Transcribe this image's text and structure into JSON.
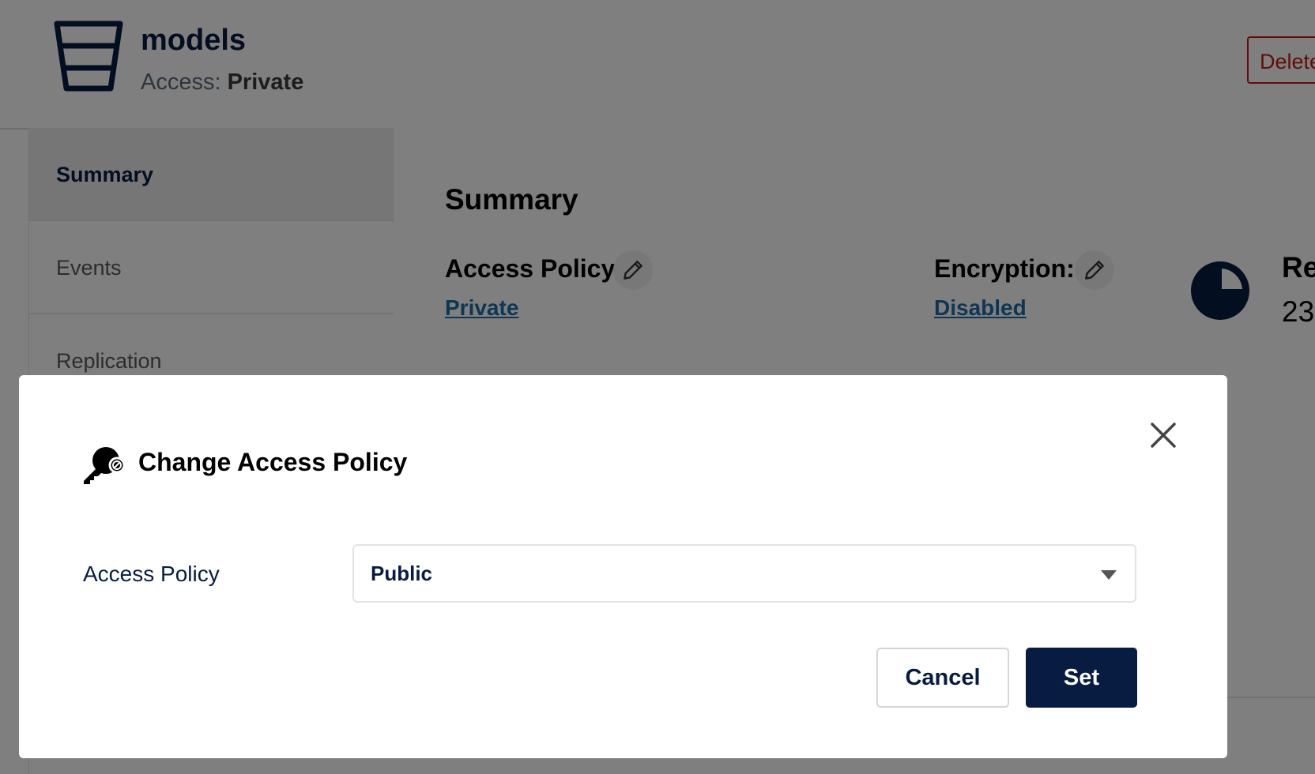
{
  "header": {
    "bucket_name": "models",
    "access_prefix": "Access:",
    "access_value": "Private",
    "delete_label": "Delete"
  },
  "sidebar": {
    "items": [
      {
        "label": "Summary",
        "active": true
      },
      {
        "label": "Events",
        "active": false
      },
      {
        "label": "Replication",
        "active": false
      }
    ]
  },
  "summary": {
    "title": "Summary",
    "access_policy_label": "Access Policy:",
    "access_policy_value": "Private",
    "encryption_label": "Encryption:",
    "encryption_value": "Disabled",
    "usage_label": "Re",
    "usage_value": "23"
  },
  "modal": {
    "title": "Change Access Policy",
    "field_label": "Access Policy",
    "selected_value": "Public",
    "cancel_label": "Cancel",
    "set_label": "Set"
  },
  "icons": {
    "bucket": "bucket-icon",
    "edit": "pencil-icon",
    "usage": "pie-chart-icon",
    "modal": "key-icon",
    "close": "close-icon",
    "dropdown": "caret-down-icon"
  },
  "colors": {
    "primary": "#081c42",
    "link": "#1e6fa8",
    "danger": "#c51b16",
    "overlay": "rgba(0,0,0,0.5)"
  }
}
